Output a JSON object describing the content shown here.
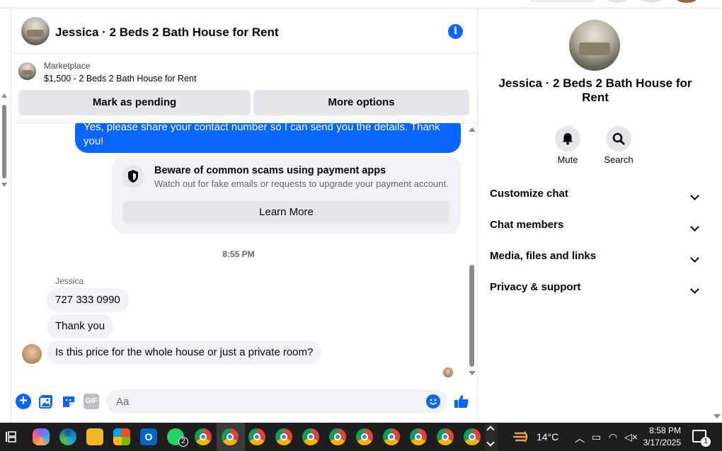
{
  "chat": {
    "title": "Jessica · 2 Beds 2 Bath House for Rent",
    "marketplace": {
      "label": "Marketplace",
      "listing": "$1,500 - 2 Beds 2 Bath House for Rent",
      "pending_button": "Mark as pending",
      "more_button": "More options"
    },
    "messages": {
      "outgoing": "Yes, please share your contact number so I can send you the details. Thank you!",
      "scam_notice": {
        "title": "Beware of common scams using payment apps",
        "body": "Watch out for fake emails or requests to upgrade your payment account.",
        "button": "Learn More"
      },
      "timestamp": "8:55 PM",
      "sender": "Jessica",
      "incoming": [
        "727 333 0990",
        "Thank you",
        "Is this price for the whole house or just a private room?"
      ]
    },
    "composer": {
      "placeholder": "Aa",
      "gif_label": "GIF"
    }
  },
  "sidebar": {
    "title": "Jessica · 2 Beds 2 Bath House for Rent",
    "actions": {
      "mute": "Mute",
      "search": "Search"
    },
    "sections": [
      "Customize chat",
      "Chat members",
      "Media, files and links",
      "Privacy & support"
    ]
  },
  "taskbar": {
    "temperature": "14°C",
    "time": "8:58 PM",
    "date": "3/17/2025",
    "whatsapp_badge": "2",
    "notification_badge": "1"
  },
  "colors": {
    "accent": "#0866ff",
    "bubble_gray": "#f0f2f5",
    "button_gray": "#e4e6eb",
    "taskbar": "#1e1e1e"
  }
}
